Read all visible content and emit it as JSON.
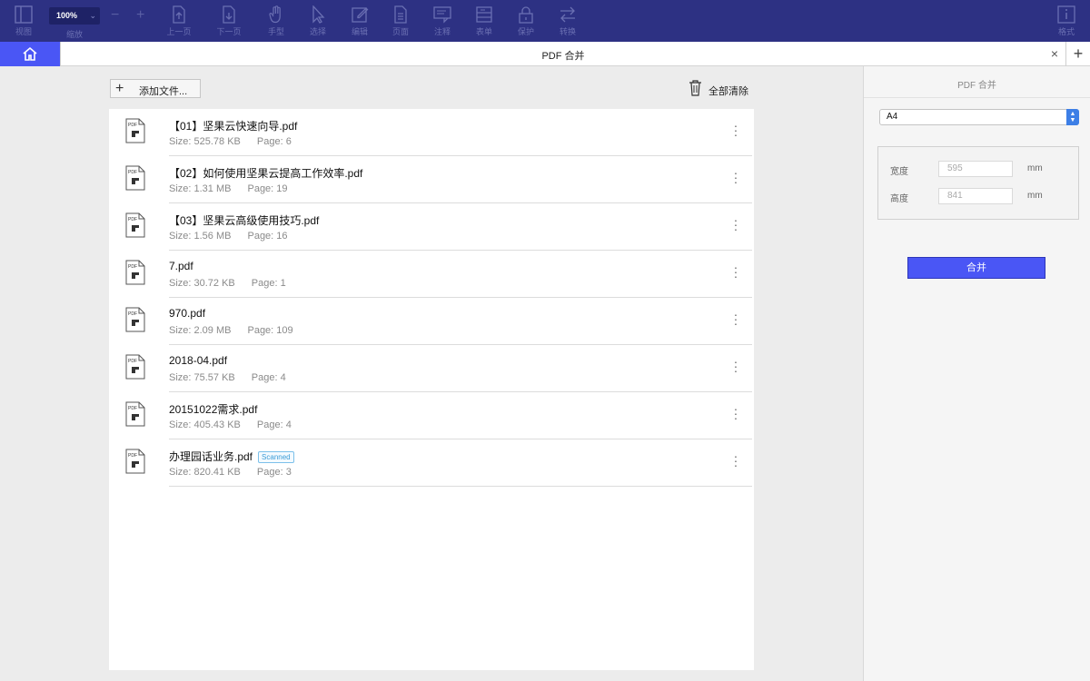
{
  "toolbar": {
    "items": [
      {
        "label": "视图",
        "icon": "view-icon"
      },
      {
        "label": "上一页",
        "icon": "page-up-icon"
      },
      {
        "label": "下一页",
        "icon": "page-down-icon"
      },
      {
        "label": "手型",
        "icon": "hand-icon"
      },
      {
        "label": "选择",
        "icon": "select-icon"
      },
      {
        "label": "编辑",
        "icon": "edit-icon"
      },
      {
        "label": "页面",
        "icon": "page-icon"
      },
      {
        "label": "注释",
        "icon": "comment-icon"
      },
      {
        "label": "表单",
        "icon": "form-icon"
      },
      {
        "label": "保护",
        "icon": "lock-icon"
      },
      {
        "label": "转换",
        "icon": "convert-icon"
      },
      {
        "label": "格式",
        "icon": "format-icon"
      }
    ],
    "zoom": {
      "value": "100%",
      "label": "缩放",
      "minus": "−",
      "plus": "+"
    }
  },
  "tabs": {
    "home_icon": "home-icon",
    "active_title": "PDF 合并",
    "close": "×",
    "add": "+"
  },
  "actions": {
    "add_file_icon": "+",
    "add_file": "添加文件...",
    "clear_all": "全部清除"
  },
  "files": [
    {
      "name": "【01】坚果云快速向导.pdf",
      "size": "Size: 525.78 KB",
      "pages": "Page: 6",
      "badge": ""
    },
    {
      "name": "【02】如何使用坚果云提高工作效率.pdf",
      "size": "Size: 1.31 MB",
      "pages": "Page: 19",
      "badge": ""
    },
    {
      "name": "【03】坚果云高级使用技巧.pdf",
      "size": "Size: 1.56 MB",
      "pages": "Page: 16",
      "badge": ""
    },
    {
      "name": "7.pdf",
      "size": "Size: 30.72 KB",
      "pages": "Page: 1",
      "badge": ""
    },
    {
      "name": "970.pdf",
      "size": "Size: 2.09 MB",
      "pages": "Page: 109",
      "badge": ""
    },
    {
      "name": "2018-04.pdf",
      "size": "Size: 75.57 KB",
      "pages": "Page: 4",
      "badge": ""
    },
    {
      "name": "20151022需求.pdf",
      "size": "Size: 405.43 KB",
      "pages": "Page: 4",
      "badge": ""
    },
    {
      "name": "办理园话业务.pdf",
      "size": "Size: 820.41 KB",
      "pages": "Page: 3",
      "badge": "Scanned"
    }
  ],
  "settings": {
    "title": "PDF 合并",
    "page_size": "A4",
    "width_label": "宽度",
    "width_value": "595",
    "height_label": "高度",
    "height_value": "841",
    "unit": "mm",
    "merge_button": "合并"
  },
  "colors": {
    "toolbar_bg": "#2d3183",
    "accent": "#4a56f5",
    "badge": "#3a9bd6"
  }
}
